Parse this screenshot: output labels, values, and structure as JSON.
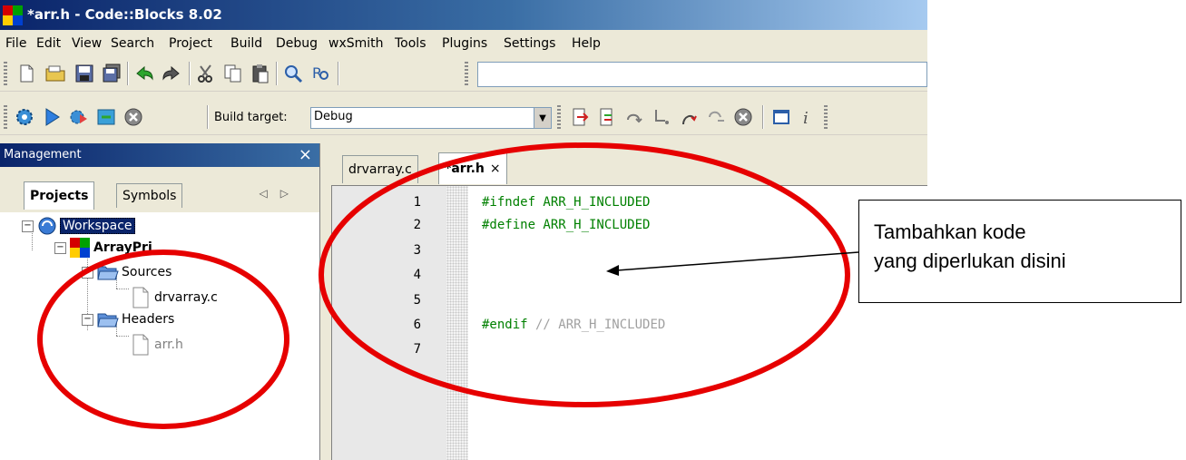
{
  "window": {
    "title": "*arr.h - Code::Blocks 8.02"
  },
  "menu": [
    "File",
    "Edit",
    "View",
    "Search",
    "Project",
    "Build",
    "Debug",
    "wxSmith",
    "Tools",
    "Plugins",
    "Settings",
    "Help"
  ],
  "toolbar": {
    "build_target_label": "Build target:",
    "build_target_value": "Debug"
  },
  "management": {
    "title": "Management",
    "close": "×",
    "tabs": {
      "projects": "Projects",
      "symbols": "Symbols"
    },
    "tree": {
      "workspace": "Workspace",
      "project": "ArrayPrj",
      "sources": "Sources",
      "source_file": "drvarray.c",
      "headers": "Headers",
      "header_file": "arr.h"
    }
  },
  "editor": {
    "tabs": {
      "drvarray": "drvarray.c",
      "arr": "*arr.h",
      "close": "×"
    },
    "lines": [
      {
        "n": "1",
        "code": "#ifndef ARR_H_INCLUDED",
        "comment": ""
      },
      {
        "n": "2",
        "code": "#define ARR_H_INCLUDED",
        "comment": ""
      },
      {
        "n": "3",
        "code": "",
        "comment": ""
      },
      {
        "n": "4",
        "code": "",
        "comment": ""
      },
      {
        "n": "5",
        "code": "",
        "comment": ""
      },
      {
        "n": "6",
        "code": "#endif",
        "comment": " // ARR_H_INCLUDED"
      },
      {
        "n": "7",
        "code": "",
        "comment": ""
      }
    ]
  },
  "annotation": {
    "line1": "Tambahkan kode",
    "line2": "yang diperlukan disini",
    "highlight_color": "#e60000"
  }
}
